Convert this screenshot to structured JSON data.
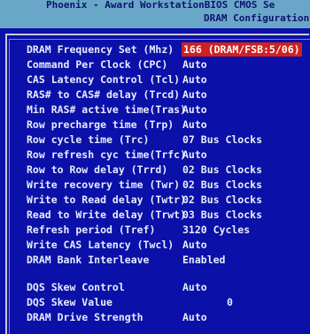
{
  "header": {
    "title": "Phoenix - Award WorkstationBIOS CMOS Se",
    "subtitle": "DRAM Configuration"
  },
  "settings": [
    {
      "label": "DRAM Frequency Set  (Mhz)",
      "value": "166 (DRAM/FSB:5/06)"
    },
    {
      "label": "Command Per Clock   (CPC)",
      "value": "Auto"
    },
    {
      "label": "CAS Latency Control (Tcl)",
      "value": "Auto"
    },
    {
      "label": "RAS# to CAS# delay (Trcd)",
      "value": "Auto"
    },
    {
      "label": "Min RAS# active time(Tras)",
      "value": "Auto"
    },
    {
      "label": "Row precharge time  (Trp)",
      "value": "Auto"
    },
    {
      "label": "Row cycle time      (Trc)",
      "value": "07 Bus Clocks"
    },
    {
      "label": "Row refresh cyc time(Trfc)",
      "value": "Auto"
    },
    {
      "label": "Row to Row delay   (Trrd)",
      "value": "02 Bus Clocks"
    },
    {
      "label": "Write recovery time (Twr)",
      "value": "02 Bus Clocks"
    },
    {
      "label": "Write to Read delay (Twtr)",
      "value": "02 Bus Clocks"
    },
    {
      "label": "Read to Write delay (Trwt)",
      "value": "03 Bus Clocks"
    },
    {
      "label": "Refresh period     (Tref)",
      "value": "3120 Cycles"
    },
    {
      "label": "Write CAS Latency  (Twcl)",
      "value": "Auto"
    },
    {
      "label": "DRAM Bank Interleave",
      "value": "Enabled"
    },
    {
      "label": "DQS Skew Control",
      "value": "Auto"
    },
    {
      "label": "DQS Skew Value",
      "value": "0"
    },
    {
      "label": "DRAM Drive Strength",
      "value": "Auto"
    }
  ],
  "selected_index": 0,
  "colors": {
    "background": "#0a10a8",
    "header": "#6aa6c8",
    "text": "#e8ecff",
    "highlight": "#d02020"
  }
}
